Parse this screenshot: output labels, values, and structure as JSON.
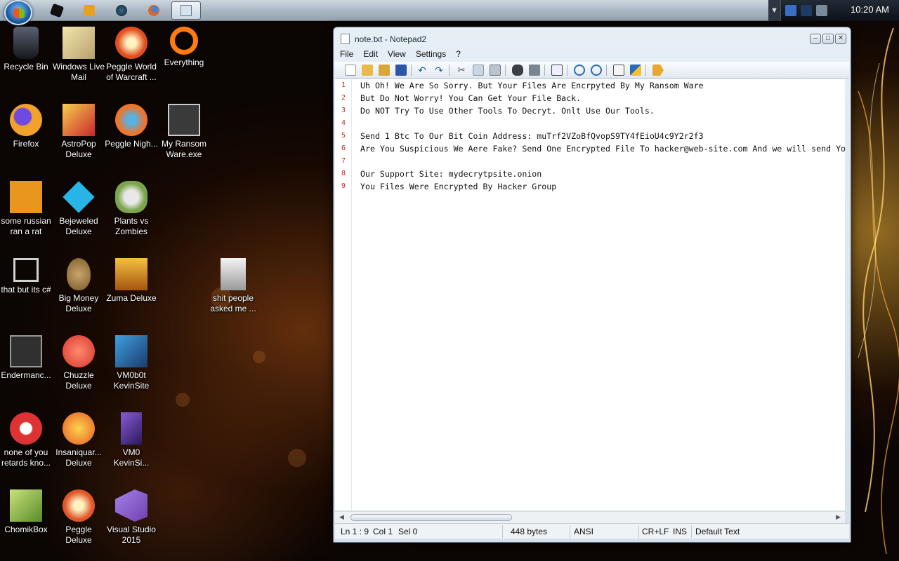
{
  "taskbar": {
    "start_label": "Start",
    "pinned": [
      {
        "name": "blackbox-icon",
        "color": "#111111"
      },
      {
        "name": "media-player-icon",
        "color": "#e8a020"
      },
      {
        "name": "dark-orb-icon",
        "color": "#0c1f2e"
      },
      {
        "name": "firefox-icon",
        "color": "#e2661d"
      },
      {
        "name": "notepad-icon",
        "color": "#d7e3ee"
      }
    ],
    "clock": "10:20 AM"
  },
  "desktop": {
    "icons": [
      {
        "label": "Recycle Bin",
        "color": "#2a2f3a"
      },
      {
        "label": "Windows Live Mail",
        "color": "#d7c48d"
      },
      {
        "label": "Peggle World of Warcraft ...",
        "color": "#e04e1e"
      },
      {
        "label": "Everything",
        "color": "#ff7a10"
      },
      {
        "label": "Firefox",
        "color": "#f2a12b"
      },
      {
        "label": "AstroPop Deluxe",
        "color": "#c9262f"
      },
      {
        "label": "Peggle Nigh...",
        "color": "#f0742a"
      },
      {
        "label": "My Ransom Ware.exe",
        "color": "#3a3a3a"
      },
      {
        "label": "some russian ran a rat",
        "color": "#e9961e"
      },
      {
        "label": "Bejeweled Deluxe",
        "color": "#27b4e6"
      },
      {
        "label": "Plants vs Zombies",
        "color": "#7aa54a"
      },
      {
        "label": "that but its c#",
        "color": "#d0d0d0"
      },
      {
        "label": "Big Money Deluxe",
        "color": "#7a5a2a"
      },
      {
        "label": "Zuma Deluxe",
        "color": "#d98f1a"
      },
      {
        "label": "shit people asked me ...",
        "color": "#d9d9d9"
      },
      {
        "label": "Endermanc...",
        "color": "#303030"
      },
      {
        "label": "Chuzzle Deluxe",
        "color": "#d7342a"
      },
      {
        "label": "VM0b0t KevinSite",
        "color": "#1c3a6c"
      },
      {
        "label": "none of you retards kno...",
        "color": "#f2f2f2"
      },
      {
        "label": "Insaniquar... Deluxe",
        "color": "#e35b28"
      },
      {
        "label": "VM0 KevinSi...",
        "color": "#4a2a8a"
      },
      {
        "label": "ChomikBox",
        "color": "#8cbd45"
      },
      {
        "label": "Peggle Deluxe",
        "color": "#e0572a"
      },
      {
        "label": "Visual Studio 2015",
        "color": "#6e3fb0"
      }
    ]
  },
  "notepad": {
    "title": "note.txt - Notepad2",
    "menu": [
      "File",
      "Edit",
      "View",
      "Settings",
      "?"
    ],
    "lines": [
      {
        "n": "1",
        "text": "Uh Oh! We Are So Sorry. But Your Files Are Encrpyted By My Ransom Ware"
      },
      {
        "n": "2",
        "text": "But Do Not Worry! You Can Get Your File Back."
      },
      {
        "n": "3",
        "text": "Do NOT Try To Use Other Tools To Decryt. Onlt Use Our Tools."
      },
      {
        "n": "4",
        "text": ""
      },
      {
        "n": "5",
        "text": "Send 1 Btc To Our Bit Coin Address: muTrf2VZoBfQvopS9TY4fEioU4c9Y2r2f3"
      },
      {
        "n": "6",
        "text": "Are You Suspicious We Aere Fake? Send One Encrypted File To hacker@web-site.com And we will send Yo"
      },
      {
        "n": "7",
        "text": ""
      },
      {
        "n": "8",
        "text": "Our Support Site: mydecrytpsite.onion"
      },
      {
        "n": "9",
        "text": "You Files Were Encrypted By Hacker Group"
      }
    ],
    "status": {
      "position": "Ln 1 : 9",
      "col": "Col 1",
      "sel": "Sel 0",
      "size": "448 bytes",
      "encoding": "ANSI",
      "eol": "CR+LF",
      "mode": "INS",
      "scheme": "Default Text"
    }
  }
}
